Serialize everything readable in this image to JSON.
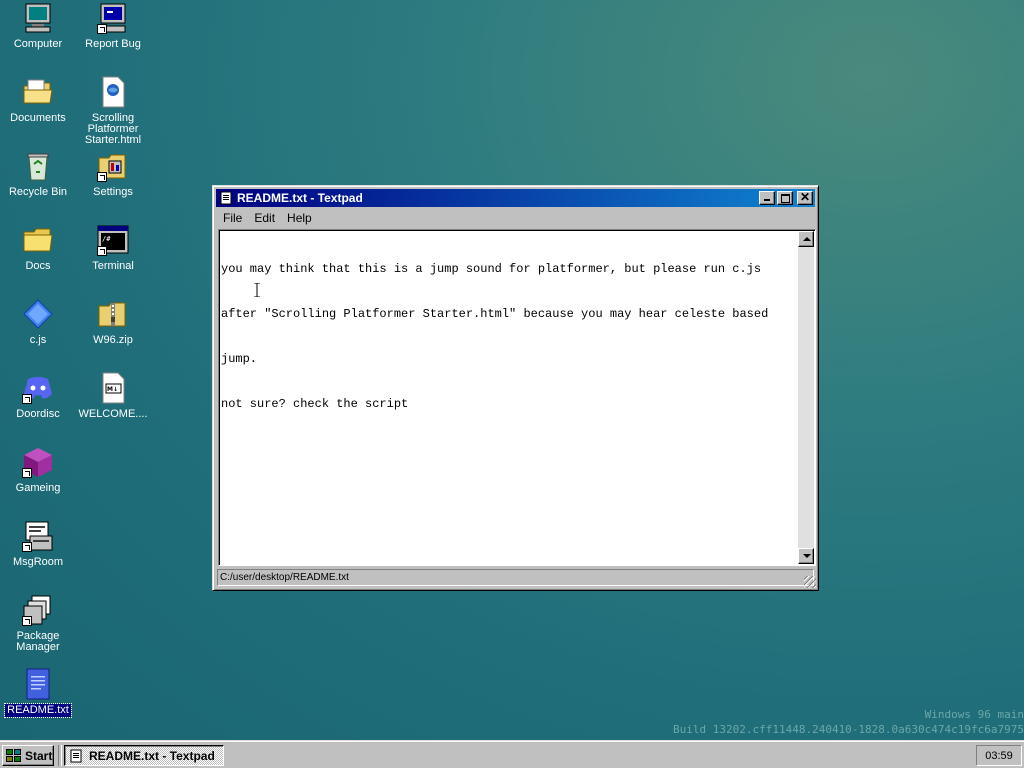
{
  "desktop": {
    "icons": [
      {
        "label": "Computer",
        "icon": "computer-icon"
      },
      {
        "label": "Report Bug",
        "icon": "report-bug-icon"
      },
      {
        "label": "Documents",
        "icon": "documents-folder-icon"
      },
      {
        "label": "Scrolling Platformer Starter.html",
        "icon": "html-file-icon"
      },
      {
        "label": "Recycle Bin",
        "icon": "recycle-bin-icon"
      },
      {
        "label": "Settings",
        "icon": "settings-icon"
      },
      {
        "label": "Docs",
        "icon": "folder-icon"
      },
      {
        "label": "Terminal",
        "icon": "terminal-icon"
      },
      {
        "label": "c.js",
        "icon": "js-file-icon"
      },
      {
        "label": "W96.zip",
        "icon": "zip-file-icon"
      },
      {
        "label": "Doordisc",
        "icon": "discord-icon"
      },
      {
        "label": "WELCOME....",
        "icon": "markdown-file-icon"
      },
      {
        "label": "Gameing",
        "icon": "cube-icon"
      },
      {
        "label": "MsgRoom",
        "icon": "msgroom-icon"
      },
      {
        "label": "Package Manager",
        "icon": "package-manager-icon"
      },
      {
        "label": "README.txt",
        "icon": "text-file-icon"
      }
    ]
  },
  "window": {
    "title": "README.txt - Textpad",
    "menu": [
      "File",
      "Edit",
      "Help"
    ],
    "text_lines": [
      "you may think that this is a jump sound for platformer, but please run c.js",
      "after \"Scrolling Platformer Starter.html\" because you may hear celeste based",
      "jump.",
      "not sure? check the script"
    ],
    "status": "C:/user/desktop/README.txt"
  },
  "watermark": {
    "line1": "Windows 96 main",
    "line2": "Build 13202.cff11448.240410-1828.0a630c474c19fc6a7975"
  },
  "taskbar": {
    "start_label": "Start",
    "task_label": "README.txt - Textpad",
    "clock": "03:59"
  },
  "colors": {
    "titlebar_start": "#000080",
    "titlebar_end": "#1084d0",
    "desktop": "#1f6e7a",
    "selection": "#000080"
  }
}
